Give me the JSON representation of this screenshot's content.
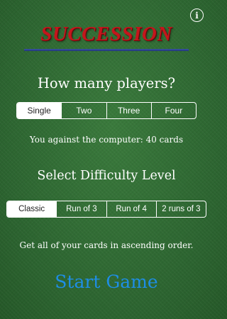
{
  "header": {
    "logo_text": "Succession",
    "info_icon": "info-icon",
    "info_glyph": "i"
  },
  "players": {
    "heading": "How many players?",
    "options": [
      "Single",
      "Two",
      "Three",
      "Four"
    ],
    "selected": "Single",
    "description": "You against the computer: 40 cards"
  },
  "difficulty": {
    "heading": "Select Difficulty Level",
    "options": [
      "Classic",
      "Run of 3",
      "Run of 4",
      "2 runs of 3"
    ],
    "selected": "Classic",
    "description": "Get all of your cards in ascending order."
  },
  "start_label": "Start Game",
  "colors": {
    "felt": "#2f6b33",
    "logo_red": "#c4161c",
    "logo_underline": "#2a4391",
    "start_blue": "#1e8ee6"
  }
}
